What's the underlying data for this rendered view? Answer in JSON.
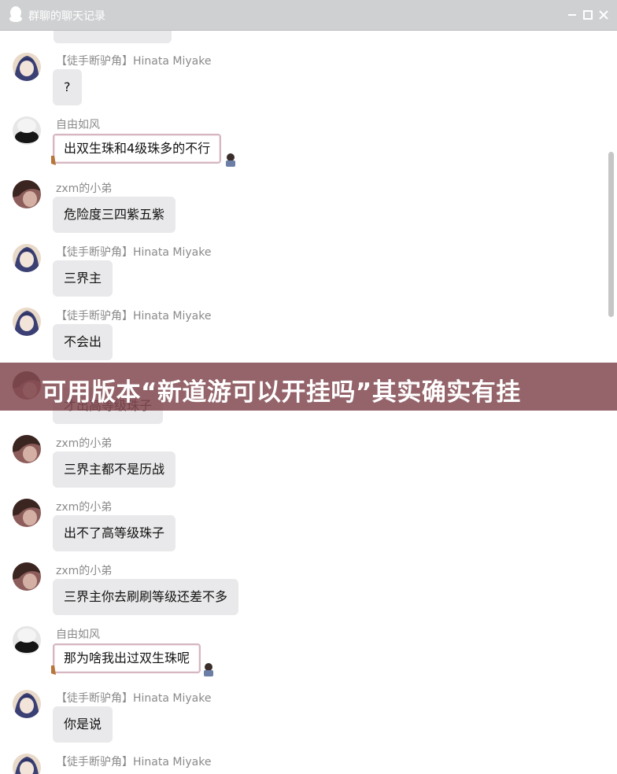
{
  "window": {
    "title": "群聊的聊天记录",
    "controls": [
      "minimize-icon",
      "maximize-icon",
      "close-icon"
    ]
  },
  "messages": [
    {
      "sender": "【徒手断驴角】Hinata Miyake",
      "text": "?",
      "avatar": "hinata-avatar",
      "style": "normal"
    },
    {
      "sender": "自由如风",
      "text": "出双生珠和4级珠多的不行",
      "avatar": "ziyou-avatar",
      "style": "frame"
    },
    {
      "sender": "zxm的小弟",
      "text": "危险度三四紫五紫",
      "avatar": "zxm-avatar",
      "style": "normal"
    },
    {
      "sender": "【徒手断驴角】Hinata Miyake",
      "text": "三界主",
      "avatar": "hinata-avatar",
      "style": "normal"
    },
    {
      "sender": "【徒手断驴角】Hinata Miyake",
      "text": "不会出",
      "avatar": "hinata-avatar",
      "style": "normal"
    },
    {
      "sender": "",
      "text": "才出高等级珠子",
      "avatar": "zxm-avatar",
      "style": "normal"
    },
    {
      "sender": "zxm的小弟",
      "text": "三界主都不是历战",
      "avatar": "zxm-avatar",
      "style": "normal"
    },
    {
      "sender": "zxm的小弟",
      "text": "出不了高等级珠子",
      "avatar": "zxm-avatar",
      "style": "normal"
    },
    {
      "sender": "zxm的小弟",
      "text": "三界主你去刷刷等级还差不多",
      "avatar": "zxm-avatar",
      "style": "normal"
    },
    {
      "sender": "自由如风",
      "text": "那为啥我出过双生珠呢",
      "avatar": "ziyou-avatar",
      "style": "frame"
    },
    {
      "sender": "【徒手断驴角】Hinata Miyake",
      "text": "你是说",
      "avatar": "hinata-avatar",
      "style": "normal"
    },
    {
      "sender": "【徒手断驴角】Hinata Miyake",
      "text": "",
      "avatar": "hinata-avatar",
      "style": "normal"
    }
  ],
  "banner": {
    "text": "可用版本“新道游可以开挂吗”其实确实有挂"
  }
}
